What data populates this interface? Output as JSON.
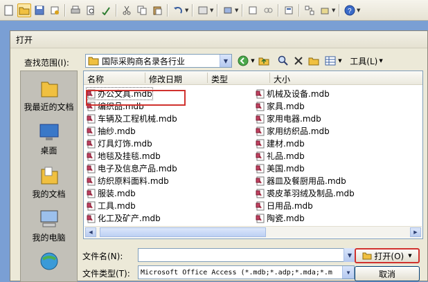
{
  "dialog": {
    "title": "打开",
    "lookin_label": "查找范围(I):",
    "lookin_value": "国际采购商名录各行业",
    "tools_label": "工具(L)"
  },
  "places": [
    {
      "label": "我最近的文档",
      "icon": "recent-documents-icon"
    },
    {
      "label": "桌面",
      "icon": "desktop-icon"
    },
    {
      "label": "我的文档",
      "icon": "my-documents-icon"
    },
    {
      "label": "我的电脑",
      "icon": "my-computer-icon"
    },
    {
      "label": "",
      "icon": "network-places-icon"
    }
  ],
  "columns": [
    "名称",
    "修改日期",
    "类型",
    "大小"
  ],
  "files_left": [
    "办公文具.mdb",
    "编织品.mdb",
    "车辆及工程机械.mdb",
    "抽纱.mdb",
    "灯具灯饰.mdb",
    "地毯及挂毯.mdb",
    "电子及信息产品.mdb",
    "纺织原料面料.mdb",
    "服装.mdb",
    "工具.mdb",
    "化工及矿产.mdb"
  ],
  "files_right": [
    "机械及设备.mdb",
    "家具.mdb",
    "家用电器.mdb",
    "家用纺织品.mdb",
    "建材.mdb",
    "礼品.mdb",
    "美国.mdb",
    "器皿及餐厨用品.mdb",
    "裘皮革羽绒及制品.mdb",
    "日用品.mdb",
    "陶瓷.mdb"
  ],
  "filename_label": "文件名(N):",
  "filename_value": "",
  "filetype_label": "文件类型(T):",
  "filetype_value": "Microsoft Office Access (*.mdb;*.adp;*.mda;*.m",
  "open_button": "打开(O)",
  "cancel_button": "取消",
  "colors": {
    "selection_highlight": "#d0312d",
    "dialog_bg": "#ece9d8"
  }
}
